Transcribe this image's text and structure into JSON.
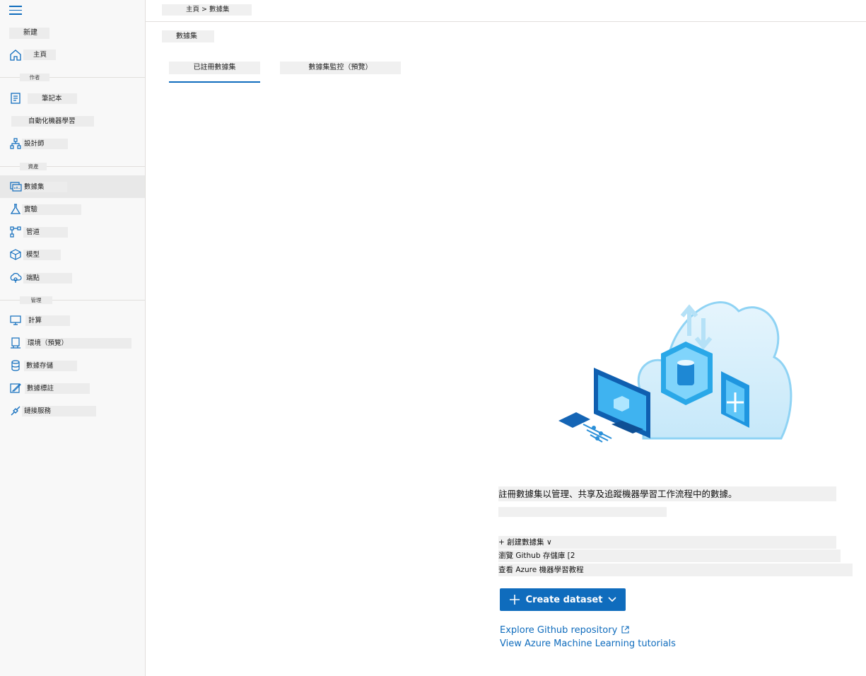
{
  "sidebar": {
    "new_label": "新建",
    "home_label": "主頁",
    "sections": {
      "author": "作者",
      "assets": "資產",
      "manage": "管理"
    },
    "items": {
      "notebooks": "筆記本",
      "automl": "自動化機器學習",
      "designer": "設計師",
      "datasets": "數據集",
      "experiments": "實驗",
      "pipelines": "管道",
      "models": "模型",
      "endpoints": "端點",
      "compute": "計算",
      "environments": "環境（預覽）",
      "datastores": "數據存儲",
      "data_labeling": "數據標註",
      "linked_services": "鏈接服務"
    }
  },
  "header": {
    "breadcrumb": "主頁 > 數據集",
    "page_title": "數據集"
  },
  "tabs": [
    {
      "label": "已註冊數據集",
      "selected": true
    },
    {
      "label": "數據集監控（預覽）",
      "selected": false
    }
  ],
  "empty_state": {
    "description": "註冊數據集以管理、共享及追蹤機器學習工作流程中的數據。",
    "sub_description": "",
    "create_menu_line": "+ 創建數據集 ∨",
    "github_line": "瀏覽 Github 存儲庫 [2",
    "tutorials_line": "查看 Azure 機器學習教程",
    "create_button_label": "Create dataset",
    "github_link": "Explore Github repository",
    "tutorials_link": "View Azure Machine Learning tutorials"
  },
  "colors": {
    "accent": "#0f6cbd",
    "sidebar_bg": "#f8f8f8",
    "selected_bg": "#e8e8e8"
  },
  "icons": {
    "menu": "hamburger-icon",
    "home": "home-icon",
    "notebooks": "notebook-icon",
    "designer": "designer-icon",
    "datasets": "dataset-icon",
    "experiments": "flask-icon",
    "pipelines": "pipeline-icon",
    "models": "cube-icon",
    "endpoints": "endpoint-icon",
    "compute": "monitor-icon",
    "environments": "environment-icon",
    "datastores": "database-icon",
    "data_labeling": "edit-icon",
    "linked_services": "link-icon"
  }
}
